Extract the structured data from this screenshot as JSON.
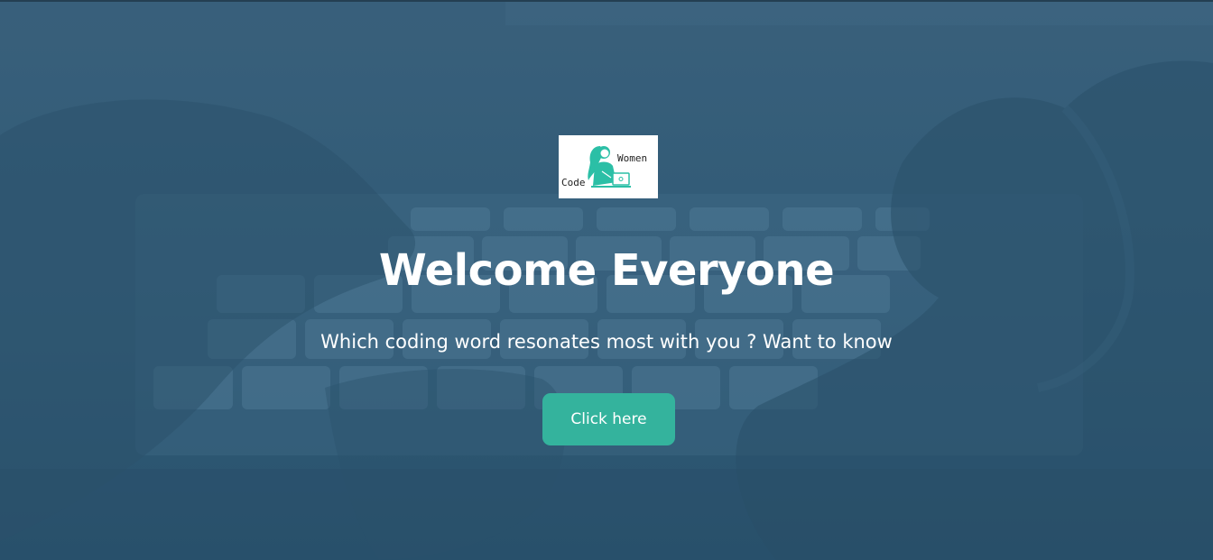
{
  "hero": {
    "logo": {
      "word_left": "Code",
      "word_right": "Women",
      "accent_color": "#2bbfa6"
    },
    "title": "Welcome Everyone",
    "subtitle": "Which coding word resonates most with you ? Want to know",
    "cta_label": "Click here",
    "cta_color": "#34b39d",
    "background_color": "#3a6280"
  }
}
